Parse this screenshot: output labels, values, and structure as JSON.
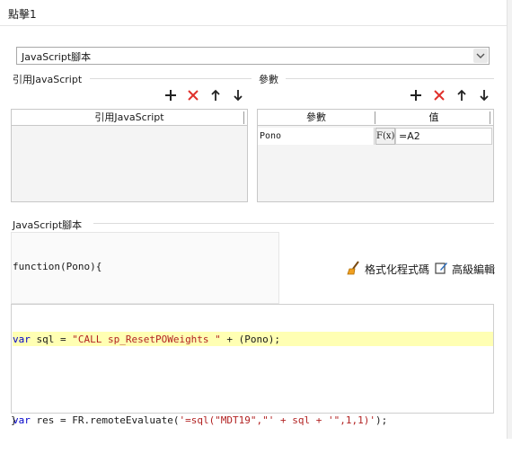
{
  "window": {
    "title": "點擊1"
  },
  "type_select": {
    "value": "JavaScript腳本"
  },
  "reference": {
    "section_label": "引用JavaScript",
    "column_header": "引用JavaScript",
    "rows": []
  },
  "params": {
    "section_label": "參數",
    "columns": [
      "參數",
      "值"
    ],
    "rows": [
      {
        "name": "Pono",
        "formula_icon": "F(x)",
        "value": "=A2"
      }
    ]
  },
  "script": {
    "section_label": "JavaScript腳本",
    "header_line": "function(Pono){",
    "footer_line": "}",
    "format_button": "格式化程式碼",
    "advanced_button": "高級編輯",
    "code_lines": [
      {
        "kw": "var",
        "rest": " sql = ",
        "str": "\"CALL sp_ResetPOWeights \"",
        "tail": " + (Pono);"
      },
      {
        "kw": "",
        "rest": "",
        "str": "",
        "tail": ""
      },
      {
        "kw": "var",
        "rest": " res = FR.remoteEvaluate(",
        "str": "'=sql(\"MDT19\",\"' + sql + '\",1,1)'",
        "tail": ");"
      }
    ]
  },
  "icons": {
    "add": "plus-icon",
    "delete": "x-icon",
    "up": "arrow-up-icon",
    "down": "arrow-down-icon",
    "format": "broom-icon",
    "edit": "edit-icon",
    "dropdown": "chevron-down-icon"
  },
  "colors": {
    "delete_red": "#e0312c",
    "keyword_blue": "#0000c8",
    "string_red": "#b22222",
    "highlight": "#ffffb3"
  }
}
